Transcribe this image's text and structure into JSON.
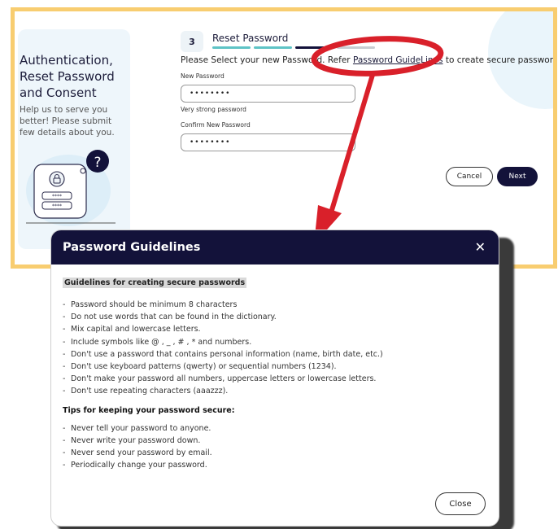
{
  "left_panel": {
    "title": "Authentication, Reset Password and Consent",
    "subtitle": "Help us to serve you better! Please submit few details about you.",
    "illustration_question": "?",
    "pin_dots_1": "****",
    "pin_dots_2": "****"
  },
  "step": {
    "number": "3",
    "title": "Reset Password",
    "progress_colors": [
      "#5ec3c6",
      "#5ec3c6",
      "#13123a",
      "#c8cdd2"
    ]
  },
  "instructions": {
    "before": "Please Select your new Password. Refer ",
    "link": "Password GuideLines",
    "after": " to create secure passwords."
  },
  "form": {
    "new_password_label": "New Password",
    "new_password_value": "••••••••",
    "strength_text": "Very strong password",
    "confirm_label": "Confirm New Password",
    "confirm_value": "••••••••"
  },
  "buttons": {
    "cancel": "Cancel",
    "next": "Next"
  },
  "modal": {
    "title": "Password Guidelines",
    "close_glyph": "✕",
    "guidelines_heading": "Guidelines for creating secure passwords",
    "guidelines": [
      "Password should be minimum 8 characters",
      "Do not use words that can be found in the dictionary.",
      "Mix capital and lowercase letters.",
      "Include symbols like @ , _ , # , * and numbers.",
      "Don't use a password that contains personal information (name, birth date, etc.)",
      "Don't use keyboard patterns (qwerty) or sequential numbers (1234).",
      "Don't make your password all numbers, uppercase letters or lowercase letters.",
      "Don't use repeating characters (aaazzz)."
    ],
    "tips_heading": "Tips for keeping your password secure:",
    "tips": [
      "Never tell your password to anyone.",
      "Never write your password down.",
      "Never send your password by email.",
      "Periodically change your password."
    ],
    "close_button": "Close"
  },
  "colors": {
    "frame_border": "#f8cd70",
    "navy": "#13123a",
    "teal": "#5ec3c6",
    "annotation_red": "#d9202a"
  }
}
